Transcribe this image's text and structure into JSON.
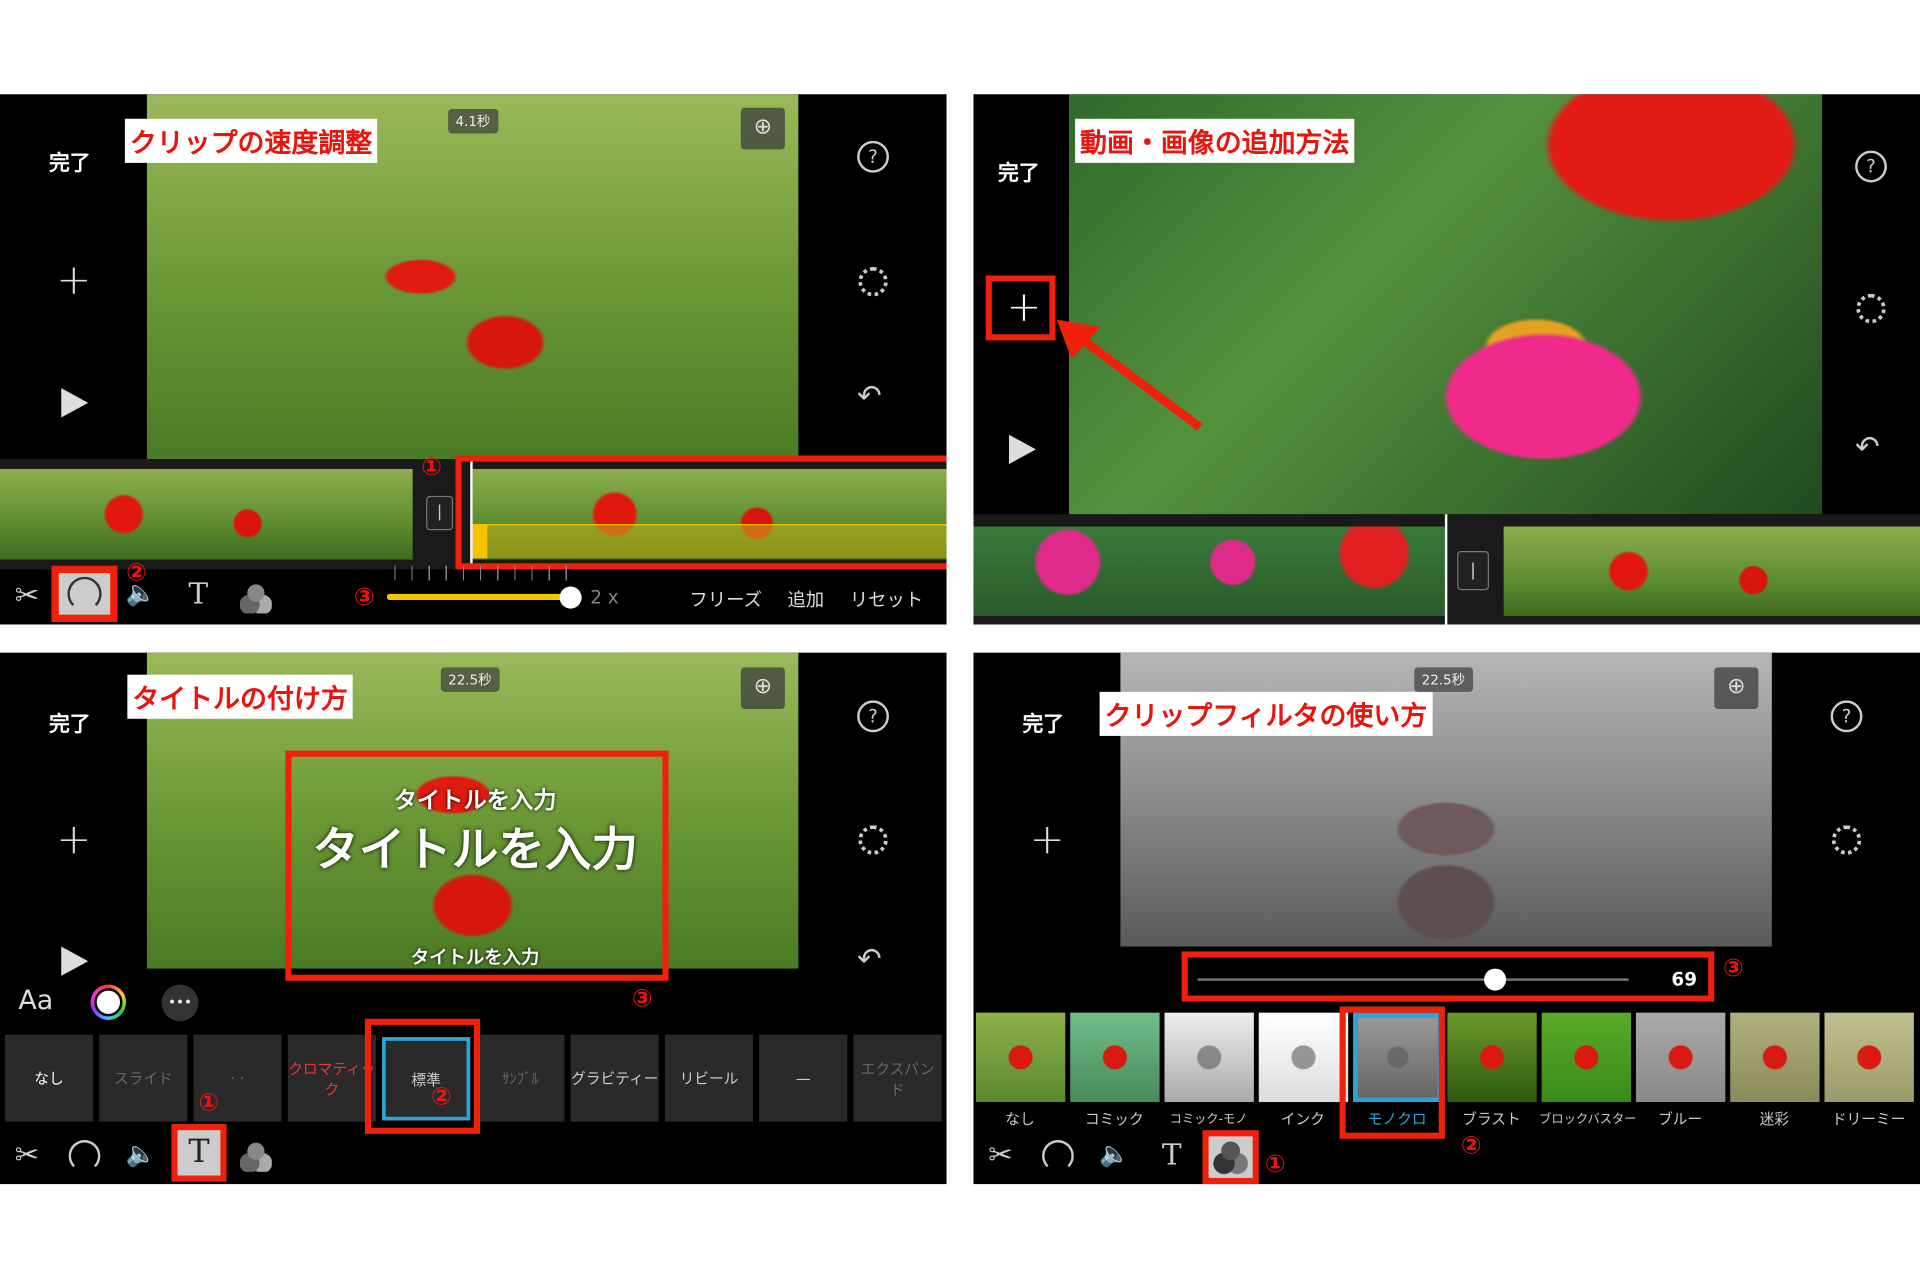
{
  "panels": {
    "speed": {
      "done": "完了",
      "label": "クリップの速度調整",
      "duration": "4.1秒",
      "steps": [
        "①",
        "②",
        "③"
      ],
      "speed_value": "2 x",
      "speed_slider_fraction": 1.0,
      "actions": [
        "フリーズ",
        "追加",
        "リセット"
      ]
    },
    "add": {
      "done": "完了",
      "label": "動画・画像の追加方法"
    },
    "title": {
      "done": "完了",
      "label": "タイトルの付け方",
      "duration": "22.5秒",
      "title_top": "タイトルを入力",
      "title_main": "タイトルを入力",
      "title_bottom": "タイトルを入力",
      "font_button": "Aa",
      "more": "•••",
      "steps": [
        "①",
        "②",
        "③"
      ],
      "styles": [
        "なし",
        "スライド",
        "· ·",
        "クロマティック",
        "標準",
        "ｻﾝﾌﾞﾙ",
        "グラビティー",
        "リビール",
        "—",
        "エクスパンド"
      ],
      "selected_style": "標準"
    },
    "filter": {
      "done": "完了",
      "label": "クリップフィルタの使い方",
      "duration": "22.5秒",
      "intensity": "69",
      "intensity_fraction": 0.69,
      "steps": [
        "①",
        "②",
        "③"
      ],
      "filters": [
        "なし",
        "コミック",
        "コミック-モノ",
        "インク",
        "モノクロ",
        "ブラスト",
        "ブロックバスター",
        "ブルー",
        "迷彩",
        "ドリーミー"
      ],
      "selected_filter": "モノクロ"
    }
  },
  "icons": {
    "help": "?",
    "zoom": "⊕",
    "undo": "↶",
    "scissors": "✂",
    "volume": "🔈",
    "text": "T"
  },
  "colors": {
    "accent_red": "#f0200a",
    "selection_blue": "#2fa3d8",
    "slider_yellow": "#f5c400"
  }
}
